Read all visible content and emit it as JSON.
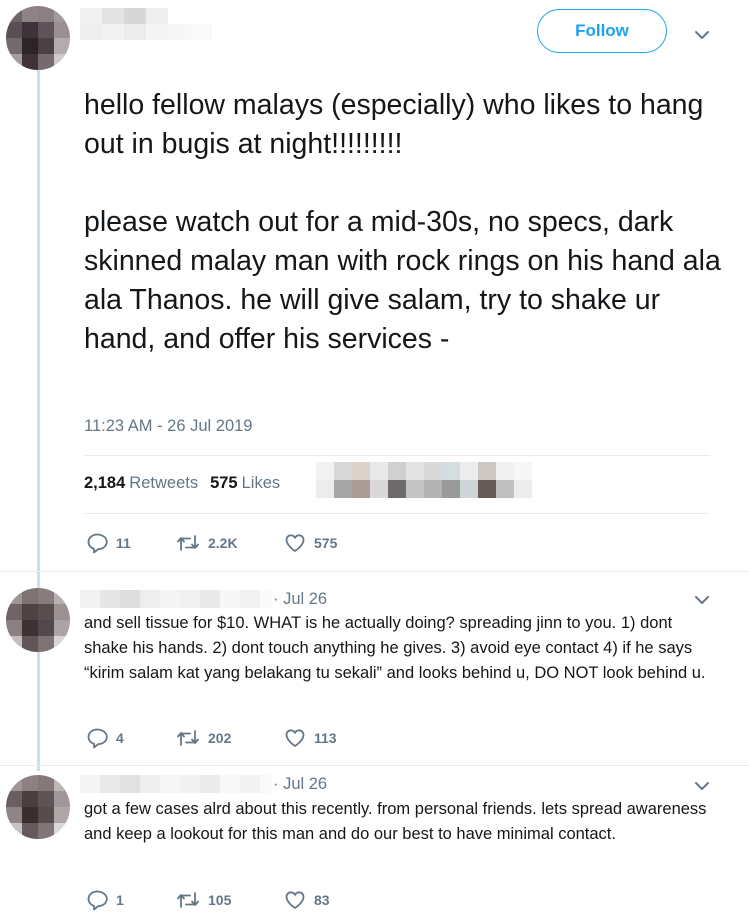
{
  "main_tweet": {
    "follow_label": "Follow",
    "text": "hello fellow malays (especially) who likes to hang out in bugis at night!!!!!!!!!\n\nplease watch out for a mid-30s, no specs, dark skinned malay man with rock rings on his hand ala ala Thanos. he will give salam, try to shake ur hand, and offer his services -",
    "timestamp": "11:23 AM - 26 Jul 2019",
    "retweets_count": "2,184",
    "retweets_label": "Retweets",
    "likes_count": "575",
    "likes_label": "Likes",
    "actions": {
      "replies": "11",
      "retweets": "2.2K",
      "likes": "575"
    }
  },
  "replies": [
    {
      "date": "· Jul 26",
      "text": "and sell tissue for $10. WHAT is he actually doing? spreading jinn to you. 1) dont shake his hands. 2) dont touch anything he gives. 3) avoid eye contact 4) if he says “kirim salam kat yang belakang tu sekali” and looks behind u, DO NOT look behind u.",
      "actions": {
        "replies": "4",
        "retweets": "202",
        "likes": "113"
      }
    },
    {
      "date": "· Jul 26",
      "text": "got a few cases alrd about this recently. from personal friends. lets spread awareness and keep a lookout for this man and do our best to have minimal contact.",
      "actions": {
        "replies": "1",
        "retweets": "105",
        "likes": "83"
      }
    }
  ],
  "colors": {
    "accent": "#1da1f2",
    "muted": "#657786",
    "text": "#14171a",
    "thread": "#c4e1f6",
    "like": "#e0245e"
  },
  "icons": {
    "reply": "reply-icon",
    "retweet": "retweet-icon",
    "like": "heart-icon",
    "more": "chevron-down-icon"
  }
}
